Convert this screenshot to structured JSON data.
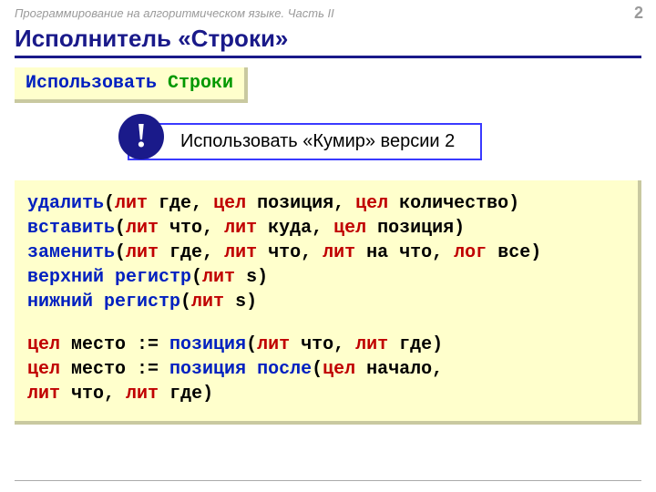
{
  "header": {
    "subtitle": "Программирование на алгоритмическом языке. Часть II",
    "page": "2"
  },
  "title": "Исполнитель «Строки»",
  "use_line": {
    "kw": "Использовать ",
    "module": "Строки"
  },
  "callout": {
    "icon": "!",
    "text": "Использовать «Кумир» версии 2"
  },
  "code": {
    "l1": {
      "t1": "удалить",
      "t2": "(",
      "t3": "лит ",
      "t4": "где",
      "t5": ", ",
      "t6": "цел ",
      "t7": "позиция",
      "t8": ", ",
      "t9": "цел ",
      "t10": "количество",
      "t11": ")"
    },
    "l2": {
      "t1": "вставить",
      "t2": "(",
      "t3": "лит ",
      "t4": "что",
      "t5": ", ",
      "t6": "лит ",
      "t7": "куда",
      "t8": ", ",
      "t9": "цел ",
      "t10": "позиция",
      "t11": ")"
    },
    "l3": {
      "t1": "заменить",
      "t2": "(",
      "t3": "лит ",
      "t4": "где",
      "t5": ", ",
      "t6": "лит ",
      "t7": "что",
      "t8": ", ",
      "t9": "лит ",
      "t10": "на что",
      "t11": ", ",
      "t12": "лог ",
      "t13": "все",
      "t14": ")"
    },
    "l4": {
      "t1": "верхний регистр",
      "t2": "(",
      "t3": "лит ",
      "t4": "s",
      "t5": ")"
    },
    "l5": {
      "t1": "нижний регистр",
      "t2": "(",
      "t3": "лит ",
      "t4": "s",
      "t5": ")"
    },
    "l7": {
      "t1": "цел ",
      "t2": "место := ",
      "t3": "позиция",
      "t4": "(",
      "t5": "лит ",
      "t6": "что",
      "t7": ", ",
      "t8": "лит ",
      "t9": "где",
      "t10": ")"
    },
    "l8a": {
      "t1": "цел ",
      "t2": "место := ",
      "t3": "позиция после",
      "t4": "(",
      "t5": "цел ",
      "t6": "начало",
      "t7": ","
    },
    "l8b": {
      "t1": "лит ",
      "t2": "что",
      "t3": ", ",
      "t4": "лит ",
      "t5": "где",
      "t6": ")"
    }
  }
}
